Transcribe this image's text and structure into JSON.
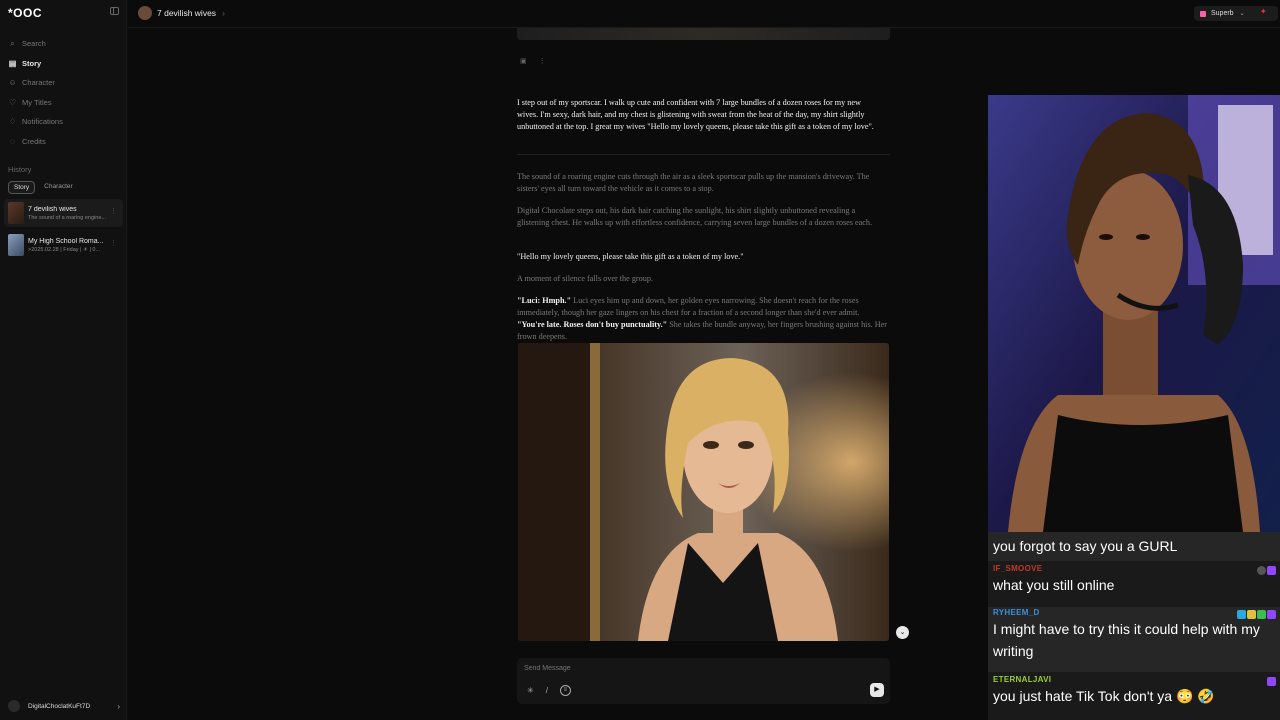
{
  "sidebar": {
    "logo": "*OOC",
    "nav": [
      {
        "icon": "search-icon",
        "glyph": "⌕",
        "label": "Search",
        "active": false
      },
      {
        "icon": "story-icon",
        "glyph": "▤",
        "label": "Story",
        "active": true
      },
      {
        "icon": "character-icon",
        "glyph": "☺",
        "label": "Character",
        "active": false
      },
      {
        "icon": "heart-icon",
        "glyph": "♡",
        "label": "My Titles",
        "active": false
      },
      {
        "icon": "bell-icon",
        "glyph": "♢",
        "label": "Notifications",
        "active": false
      },
      {
        "icon": "credits-icon",
        "glyph": "◌",
        "label": "Credits",
        "active": false
      }
    ],
    "history_label": "History",
    "history_tabs": [
      "Story",
      "Character"
    ],
    "history_items": [
      {
        "title": "7 devilish wives",
        "subtitle": "The sound of a roaring engine..."
      },
      {
        "title": "My High School Roma...",
        "subtitle": ">2025.02.28 | Friday | ☀ | 0..."
      }
    ],
    "user": "DigitalChoclatKuFt7D"
  },
  "topbar": {
    "breadcrumb": "7 devilish wives",
    "plan": "Superb"
  },
  "story": {
    "user_message": "I step out of my sportscar. I walk up cute and confident with 7 large bundles of a dozen roses for my new wives. I'm sexy, dark hair, and my chest is glistening with sweat from the heat of the day, my shirt slightly unbuttoned at the top. I great my wives \"Hello my lovely queens, please take this gift as a token of my love\".",
    "p1": "The sound of a roaring engine cuts through the air as a sleek sportscar pulls up the mansion's driveway. The sisters' eyes all turn toward the vehicle as it comes to a stop.",
    "p2": "Digital Chocolate steps out, his dark hair catching the sunlight, his shirt slightly unbuttoned revealing a glistening chest. He walks up with effortless confidence, carrying seven large bundles of a dozen roses each.",
    "p3": "\"Hello my lovely queens, please take this gift as a token of my love.\"",
    "p4": "A moment of silence falls over the group.",
    "p5_speaker": "\"Luci: Hmph.\"",
    "p5_a": " Luci eyes him up and down, her golden eyes narrowing. She doesn't reach for the roses immediately, though her gaze lingers on his chest for a fraction of a second longer than she'd ever admit. ",
    "p5_quote": "\"You're late. Roses don't buy punctuality.\"",
    "p5_b": " She takes the bundle anyway, her fingers brushing against his. Her frown deepens."
  },
  "composer": {
    "placeholder": "Send Message"
  },
  "chat": [
    {
      "user": "",
      "text": "you forgot to say you a GURL",
      "color": "#ffffff"
    },
    {
      "user": "IF_SMOOVE",
      "text": "what you still online",
      "color": "#c0392b"
    },
    {
      "user": "RYHEEM_D",
      "text": "I might have to try this it could help with my writing",
      "color": "#3a8fd8"
    },
    {
      "user": "ETERNALJAVI",
      "text": "you just hate Tik Tok don't ya 😳 🤣",
      "color": "#9acd32"
    }
  ]
}
